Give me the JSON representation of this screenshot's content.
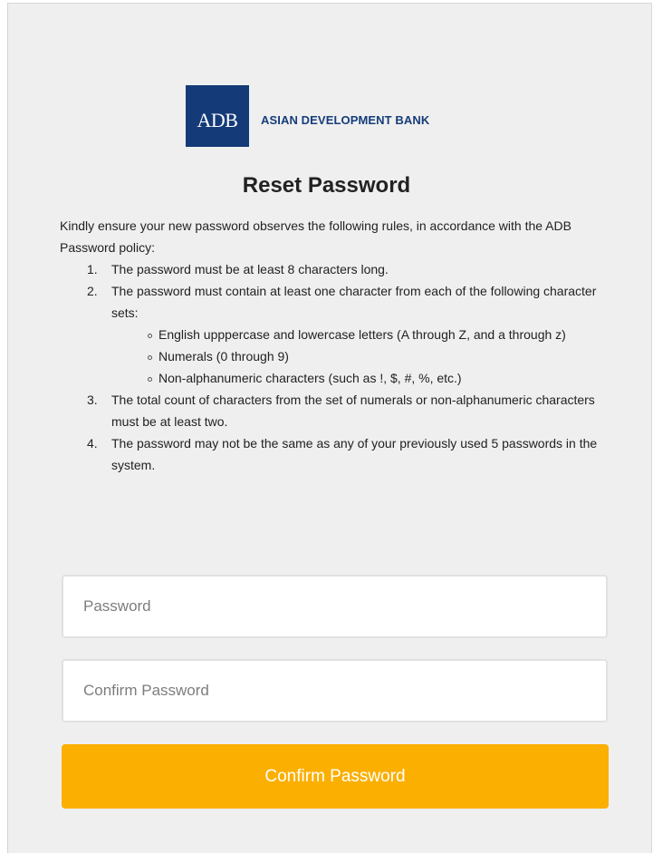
{
  "brand": {
    "logo_text": "ADB",
    "name": "ASIAN DEVELOPMENT BANK",
    "color": "#143a78"
  },
  "page_title": "Reset Password",
  "intro": "Kindly ensure your new password observes the following rules, in accordance with the ADB Password policy:",
  "rules": [
    {
      "num": "1.",
      "text": "The password must be at least 8 characters long."
    },
    {
      "num": "2.",
      "text": "The password must contain at least one character from each of the following character sets:",
      "sub": [
        "English upppercase and lowercase letters (A through Z, and a through z)",
        "Numerals (0 through 9)",
        "Non-alphanumeric characters (such as !, $, #, %, etc.)"
      ]
    },
    {
      "num": "3.",
      "text": "The total count of characters from the set of numerals or non-alphanumeric characters must be at least two."
    },
    {
      "num": "4.",
      "text": "The password may not be the same as any of your previously used 5 passwords in the system."
    }
  ],
  "form": {
    "password_placeholder": "Password",
    "password_value": "",
    "confirm_placeholder": "Confirm Password",
    "confirm_value": "",
    "submit_label": "Confirm Password",
    "submit_color": "#fbaf00"
  },
  "icons": {
    "bullet": "hollow-circle-bullet-icon"
  }
}
